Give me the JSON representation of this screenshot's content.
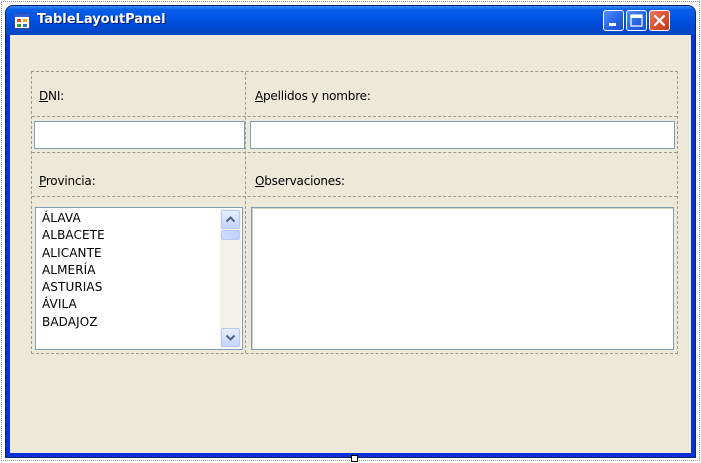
{
  "window": {
    "title": "TableLayoutPanel",
    "title_color": "#ffffff",
    "titlebar_color": "#0054e3",
    "client_color": "#ece9d8",
    "buttons": [
      "minimize",
      "maximize",
      "close"
    ]
  },
  "labels": {
    "dni": {
      "mnemonic": "D",
      "rest": "NI:"
    },
    "apellidos": {
      "mnemonic": "A",
      "rest": "pellidos y nombre:"
    },
    "provincia": {
      "mnemonic": "P",
      "rest": "rovincia:"
    },
    "observaciones": {
      "mnemonic": "O",
      "rest": "bservaciones:"
    }
  },
  "fields": {
    "dni_value": "",
    "apellidos_value": "",
    "observaciones_value": ""
  },
  "provincias": [
    "ÁLAVA",
    "ALBACETE",
    "ALICANTE",
    "ALMERÍA",
    "ASTURIAS",
    "ÁVILA",
    "BADAJOZ"
  ],
  "icons": {
    "app": "form-icon",
    "minimize": "minimize-icon",
    "maximize": "maximize-icon",
    "close": "close-icon",
    "scroll_up": "chevron-up-icon",
    "scroll_down": "chevron-down-icon"
  }
}
